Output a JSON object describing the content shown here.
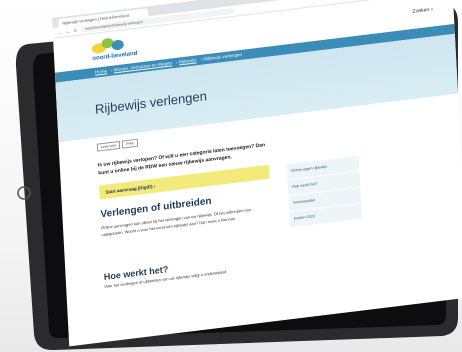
{
  "browser": {
    "tab_title": "Rijbewijs verlengen | Noord-Beveland",
    "url": "noord-beveland.nl/rijbewijs-verlengen"
  },
  "header": {
    "logo_text": "noord-beveland",
    "search_label": "Zoeken"
  },
  "breadcrumb": [
    "Home",
    "Wonen, Verhuizen en Wegen",
    "Rijbewijs",
    "Rijbewijs verlengen"
  ],
  "page": {
    "title": "Rijbewijs verlengen"
  },
  "toolbar": {
    "listen": "Lees voor",
    "print": "Print"
  },
  "intro": "Is uw rijbewijs verlopen? Of wilt u een categorie laten toevoegen? Dan kunt u online bij de RDW een nieuw rijbewijs aanvragen.",
  "cta": {
    "label": "Start aanvraag (DigiD) ›"
  },
  "section1": {
    "title": "Verlengen of uitbreiden",
    "text": "Online aanvragen kan alleen bij het verlengen van uw rijbewijs. Of het uitbreiden van categorieën. Woont u voor het eerst een rijbewijs aan? Dan moet u hiervoor"
  },
  "section2": {
    "title": "Hoe werkt het?",
    "text": "Voor het verlengen of uitbreiden van uw rijbewijs volgt u onderstaand"
  },
  "sidebar": [
    "Online eigen rijbewijs",
    "Hoe werkt het?",
    "Voorwaarden",
    "Kosten 2023"
  ],
  "colors": {
    "brand_blue": "#3b8db7",
    "hero_bg": "#d3e9f2",
    "cta_yellow": "#f2ea7a"
  }
}
